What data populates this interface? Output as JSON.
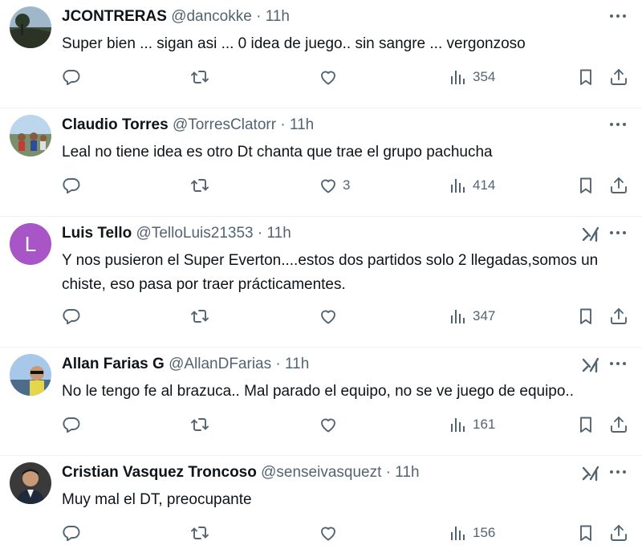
{
  "colors": {
    "text": "#0f1419",
    "muted": "#536471",
    "divider": "#eff3f4",
    "avatar_l": "#a855c7"
  },
  "tweets": [
    {
      "name": "JCONTRERAS",
      "handle": "@dancokke",
      "time": "11h",
      "text": "Super bien ... sigan asi ... 0 idea de juego.. sin sangre ... vergonzoso",
      "likes": "",
      "views": "354",
      "has_grok": false,
      "avatar_icon": "photo-avatar"
    },
    {
      "name": "Claudio Torres",
      "handle": "@TorresClatorr",
      "time": "11h",
      "text": "Leal no tiene idea es otro Dt chanta que trae el grupo  pachucha",
      "likes": "3",
      "views": "414",
      "has_grok": false,
      "avatar_icon": "photo-avatar"
    },
    {
      "name": "Luis Tello",
      "handle": "@TelloLuis21353",
      "time": "11h",
      "text": "Y nos pusieron el Super Everton....estos dos partidos solo 2 llegadas,somos un chiste, eso pasa por traer prácticamentes.",
      "likes": "",
      "views": "347",
      "has_grok": true,
      "avatar_letter": "L"
    },
    {
      "name": "Allan Farias G",
      "handle": "@AllanDFarias",
      "time": "11h",
      "text": "No le tengo fe al brazuca.. Mal parado el equipo, no se ve juego de equipo..",
      "likes": "",
      "views": "161",
      "has_grok": true,
      "avatar_icon": "photo-avatar"
    },
    {
      "name": "Cristian Vasquez Troncoso",
      "handle": "@senseivasquezt",
      "time": "11h",
      "text": "Muy mal el DT, preocupante",
      "likes": "",
      "views": "156",
      "has_grok": true,
      "avatar_icon": "photo-avatar"
    }
  ],
  "separator": "·"
}
